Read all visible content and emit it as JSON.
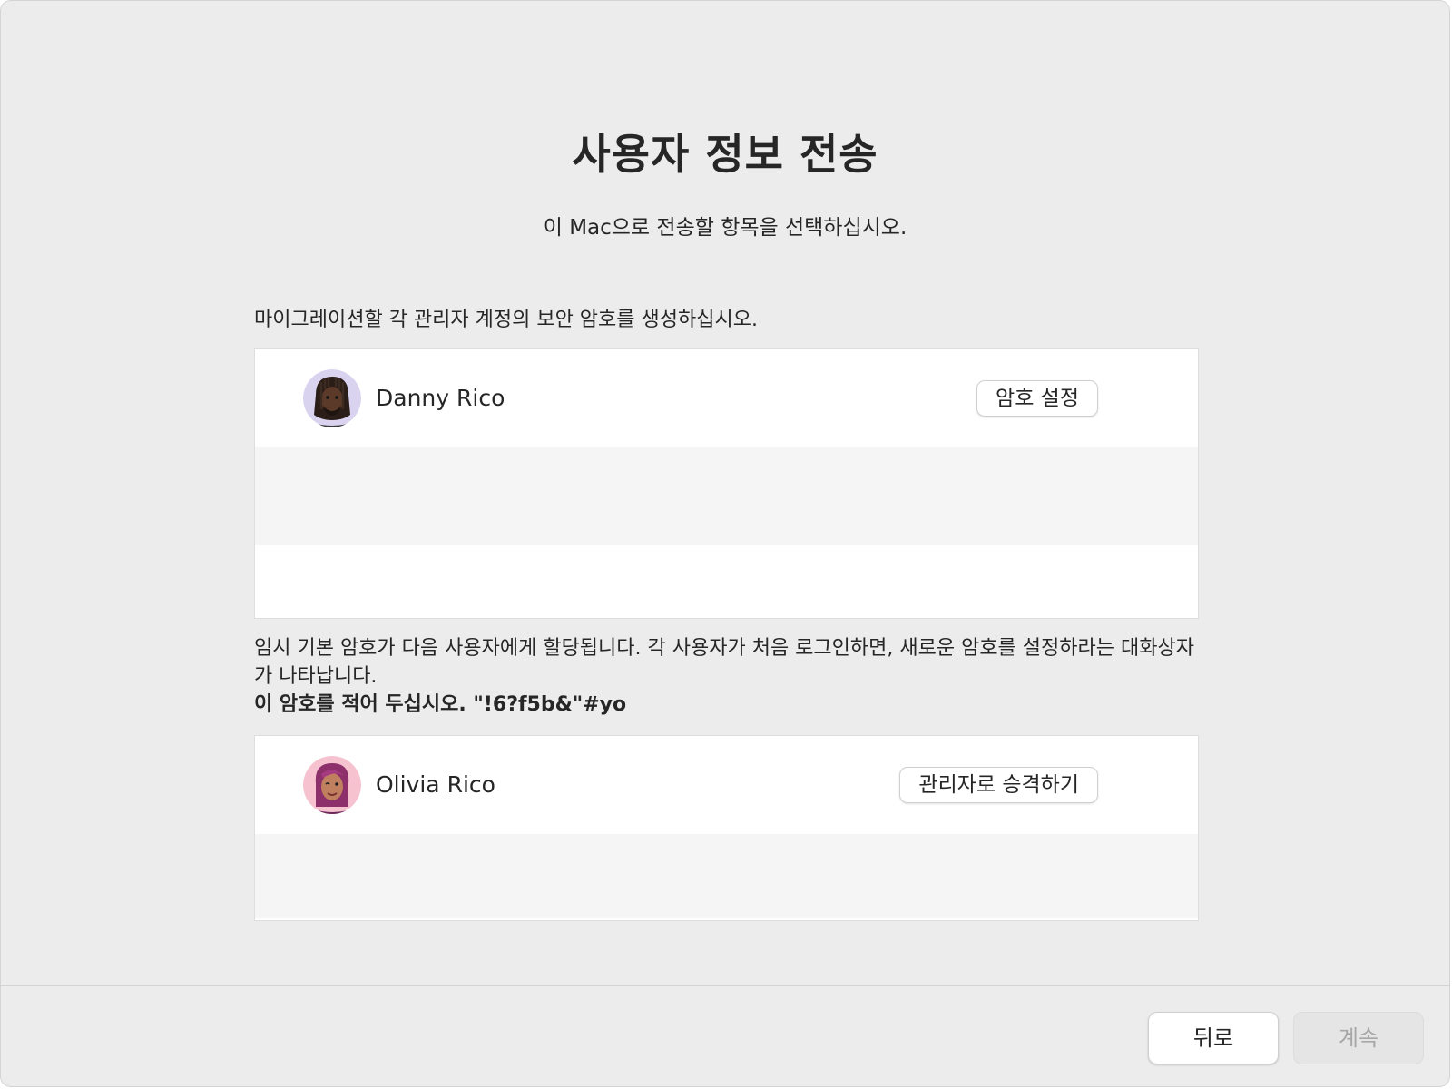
{
  "page": {
    "title": "사용자 정보 전송",
    "subtitle": "이 Mac으로 전송할 항목을 선택하십시오."
  },
  "admin_section": {
    "label": "마이그레이션할 각 관리자 계정의 보안 암호를 생성하십시오.",
    "users": [
      {
        "name": "Danny Rico",
        "avatar_icon": "memoji-avatar-icon",
        "avatar_bg": "#d9d3f0",
        "button_label": "암호 설정"
      }
    ]
  },
  "info": {
    "line": "임시 기본 암호가 다음 사용자에게 할당됩니다. 각 사용자가 처음 로그인하면, 새로운 암호를 설정하라는 대화상자가 나타납니다.",
    "strong": "이 암호를 적어 두십시오. \"!6?f5b&\"#yo"
  },
  "standard_section": {
    "users": [
      {
        "name": "Olivia Rico",
        "avatar_icon": "memoji-avatar-icon",
        "avatar_bg": "#f6c2cf",
        "button_label": "관리자로 승격하기"
      }
    ]
  },
  "footer": {
    "back_label": "뒤로",
    "continue_label": "계속",
    "continue_enabled": false
  }
}
